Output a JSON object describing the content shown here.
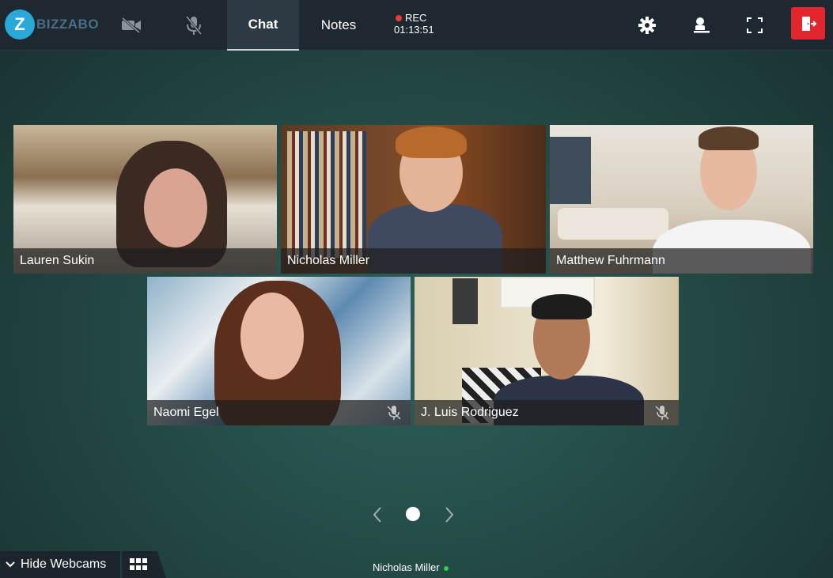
{
  "app": {
    "logo_letter": "Z",
    "logo_text": "BIZZABO"
  },
  "toolbar": {
    "camera_icon": "camera-off-icon",
    "mic_icon": "mic-off-icon",
    "tabs": [
      {
        "label": "Chat",
        "active": true
      },
      {
        "label": "Notes",
        "active": false
      }
    ],
    "rec_label": "REC",
    "rec_time": "01:13:51",
    "settings_icon": "gear-icon",
    "presenter_icon": "presenter-icon",
    "fullscreen_icon": "fullscreen-icon",
    "exit_icon": "exit-door-icon",
    "exit_color": "#e3262d"
  },
  "participants": [
    {
      "name": "Lauren Sukin",
      "muted": false,
      "speaking": false
    },
    {
      "name": "Nicholas Miller",
      "muted": false,
      "speaking": true
    },
    {
      "name": "Matthew Fuhrmann",
      "muted": false,
      "speaking": false
    },
    {
      "name": "Naomi Egel",
      "muted": true,
      "speaking": false
    },
    {
      "name": "J. Luis Rodriguez",
      "muted": true,
      "speaking": false
    }
  ],
  "pagination": {
    "current_page": 1,
    "pages": 1
  },
  "bottom_bar": {
    "hide_webcams_label": "Hide Webcams",
    "current_user": "Nicholas Miller",
    "status_color": "#2ed14a"
  },
  "colors": {
    "speaking_outline": "#1bb11b",
    "topbar_bg": "#1d2830"
  }
}
